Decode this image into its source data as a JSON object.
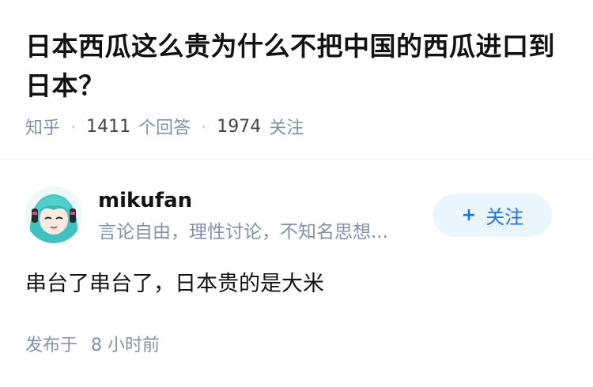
{
  "question": {
    "title": "日本西瓜这么贵为什么不把中国的西瓜进口到日本？",
    "source": "知乎",
    "answer_count": "1411",
    "answer_label": "个回答",
    "follower_count": "1974",
    "follower_label": "关注"
  },
  "author": {
    "name": "mikufan",
    "bio": "言论自由，理性讨论，不知名思想...",
    "avatar_icon": "anime-avatar-icon"
  },
  "follow_button": {
    "icon": "plus-icon",
    "label": "关注",
    "accent_color": "#1772f6"
  },
  "answer": {
    "content": "串台了串台了，日本贵的是大米",
    "time_prefix": "发布于",
    "time_value": "8 小时前"
  }
}
